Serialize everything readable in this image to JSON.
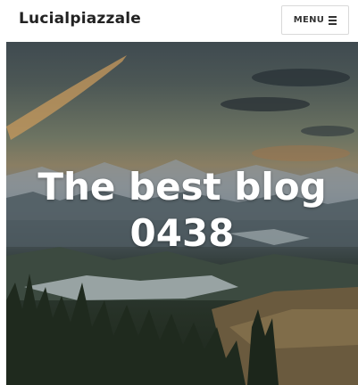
{
  "header": {
    "site_title": "Lucialpiazzale",
    "menu_label": "MENU",
    "menu_icon": "hamburger-icon"
  },
  "hero": {
    "title_line1": "The best blog",
    "title_line2": "0438",
    "image": "mountain-landscape-sunset"
  }
}
